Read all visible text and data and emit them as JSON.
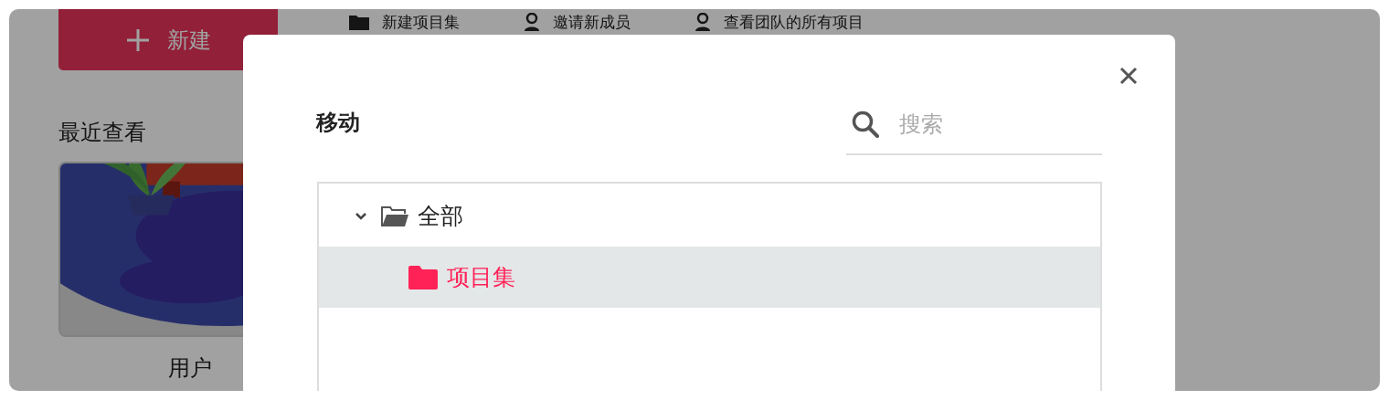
{
  "toolbar": {
    "new_button": "新建",
    "actions": [
      {
        "label": "新建项目集",
        "kind": "folder"
      },
      {
        "label": "邀请新成员",
        "kind": "person"
      },
      {
        "label": "查看团队的所有项目",
        "kind": "person"
      }
    ]
  },
  "recent": {
    "title": "最近查看",
    "cards": [
      {
        "kind": "picture",
        "name": "用户"
      }
    ]
  },
  "dialog": {
    "title": "移动",
    "search": {
      "placeholder": "搜索"
    },
    "tree": [
      {
        "label": "全部",
        "expanded": true,
        "selected": false,
        "children": [
          {
            "label": "项目集",
            "selected": true,
            "expanded": false
          }
        ]
      }
    ]
  }
}
